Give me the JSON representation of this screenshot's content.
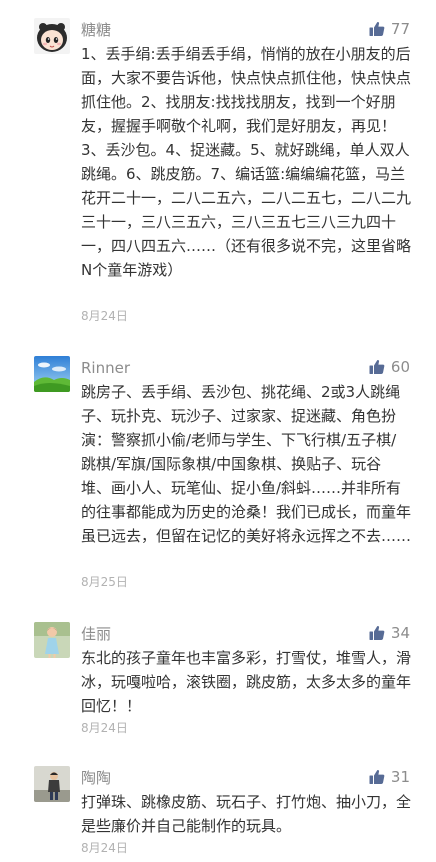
{
  "colors": {
    "username": "#8c8c8c",
    "like_icon": "#576b95",
    "text": "#333333",
    "date": "#b2b2b2"
  },
  "comments": [
    {
      "username": "糖糖",
      "likes": "77",
      "avatar_icon": "cartoon-girl-avatar",
      "content": "1、丢手绢:丢手绢丢手绢，悄悄的放在小朋友的后面，大家不要告诉他，快点快点抓住他，快点快点抓住他。2、找朋友:找找找朋友，找到一个好朋友，握握手啊敬个礼啊，我们是好朋友，再见！3、丢沙包。4、捉迷藏。5、就好跳绳，单人双人跳绳。6、跳皮筋。7、编话篮:编编编花篮，马兰花开二十一，二八二五六，二八二五七，二八二九三十一，三八三五六，三八三五七三八三九四十一，四八四五六……（还有很多说不完，这里省略N个童年游戏）",
      "date": "8月24日"
    },
    {
      "username": "Rinner",
      "likes": "60",
      "avatar_icon": "landscape-avatar",
      "content": "跳房子、丢手绢、丢沙包、挑花绳、2或3人跳绳子、玩扑克、玩沙子、过家家、捉迷藏、角色扮演：警察抓小偷/老师与学生、下飞行棋/五子棋/跳棋/军旗/国际象棋/中国象棋、换贴子、玩谷堆、画小人、玩笔仙、捉小鱼/斜蚪……并非所有的往事都能成为历史的沧桑！我们已成长，而童年虽已远去，但留在记忆的美好将永远挥之不去……",
      "date": "8月25日"
    },
    {
      "username": "佳丽",
      "likes": "34",
      "avatar_icon": "child-photo-avatar",
      "content": "东北的孩子童年也丰富多彩，打雪仗，堆雪人，滑冰，玩嘎啦哈，滚铁圈，跳皮筋，太多太多的童年回忆！！",
      "date": "8月24日"
    },
    {
      "username": "陶陶",
      "likes": "31",
      "avatar_icon": "child-outdoor-avatar",
      "content": "打弹珠、跳橡皮筋、玩石子、打竹炮、抽小刀，全是些廉价并自己能制作的玩具。",
      "date": "8月24日"
    }
  ]
}
